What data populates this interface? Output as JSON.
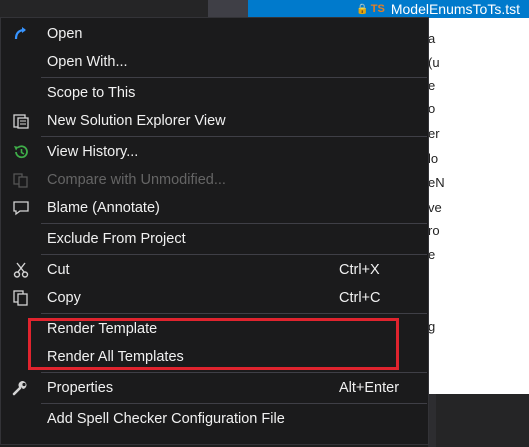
{
  "background": {
    "selected_file": "ModelEnumsToTs.tst",
    "file_badge": "TS",
    "editor_fragments": [
      "a",
      "(u",
      "e",
      "o",
      "er",
      "lo",
      "eN",
      "ve",
      "ro",
      "e",
      "g"
    ]
  },
  "menu": {
    "items": [
      {
        "label": "Open",
        "shortcut": "",
        "icon": "open-arrow-icon"
      },
      {
        "label": "Open With...",
        "shortcut": "",
        "icon": ""
      },
      {
        "label": "Scope to This",
        "shortcut": "",
        "icon": ""
      },
      {
        "label": "New Solution Explorer View",
        "shortcut": "",
        "icon": "new-view-icon"
      },
      {
        "label": "View History...",
        "shortcut": "",
        "icon": "history-icon"
      },
      {
        "label": "Compare with Unmodified...",
        "shortcut": "",
        "icon": "compare-icon",
        "disabled": true
      },
      {
        "label": "Blame (Annotate)",
        "shortcut": "",
        "icon": "comment-icon"
      },
      {
        "label": "Exclude From Project",
        "shortcut": "",
        "icon": ""
      },
      {
        "label": "Cut",
        "shortcut": "Ctrl+X",
        "icon": "scissors-icon"
      },
      {
        "label": "Copy",
        "shortcut": "Ctrl+C",
        "icon": "copy-icon"
      },
      {
        "label": "Render Template",
        "shortcut": "",
        "icon": ""
      },
      {
        "label": "Render All Templates",
        "shortcut": "",
        "icon": ""
      },
      {
        "label": "Properties",
        "shortcut": "Alt+Enter",
        "icon": "wrench-icon"
      },
      {
        "label": "Add Spell Checker Configuration File",
        "shortcut": "",
        "icon": ""
      }
    ]
  },
  "colors": {
    "menu_bg": "#1b1b1c",
    "separator": "#3f3f46",
    "selection_blue": "#007acc",
    "highlight_red": "#e0242e",
    "icon_blue": "#3794ff",
    "icon_green": "#3fae49"
  }
}
